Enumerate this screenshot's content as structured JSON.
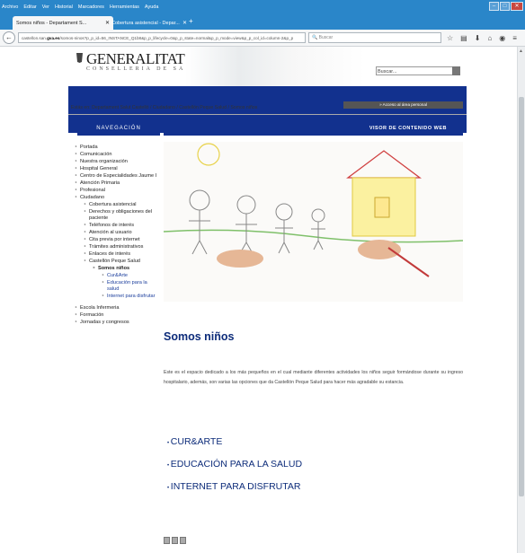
{
  "browser": {
    "menu": [
      "Archivo",
      "Editar",
      "Ver",
      "Historial",
      "Marcadores",
      "Herramientas",
      "Ayuda"
    ],
    "tabs": [
      {
        "label": "Somos niños - Departament S...",
        "active": true
      },
      {
        "label": "Cobertura asistencial - Depar...",
        "active": false
      }
    ],
    "url_prefix": "castellon.san.",
    "url_domain": "gva.es",
    "url_rest": "/somos-ninos?p_p_id=56_INSTANCE_Q1b8&p_p_lifecycle=0&p_p_state=normal&p_p_mode=view&p_p_col_id=column-2&p_p",
    "search_placeholder": "Buscar"
  },
  "header": {
    "title": "GENERALITAT VALENCIANA",
    "subtitle": "CONSELLERIA DE SANITAT",
    "search_label": "Buscar..."
  },
  "breadcrumb": "Estás en:  Departament Salut Castelló  /  Ciudadano  /  Castellón Peque Salud  /  Somos niños",
  "access_button": "» Acceso al área personal",
  "sidebar": {
    "heading": "NAVEGACIÓN",
    "items": [
      {
        "label": "Portada",
        "level": 0
      },
      {
        "label": "Comunicación",
        "level": 0
      },
      {
        "label": "Nuestra organización",
        "level": 0
      },
      {
        "label": "Hospital General",
        "level": 0
      },
      {
        "label": "Centro de Especialidades Jaume I",
        "level": 0
      },
      {
        "label": "Atención Primaria",
        "level": 0
      },
      {
        "label": "Profesional",
        "level": 0
      },
      {
        "label": "Ciudadano",
        "level": 0
      },
      {
        "label": "Cobertura asistencial",
        "level": 1
      },
      {
        "label": "Derechos y obligaciones del paciente",
        "level": 1
      },
      {
        "label": "Teléfonos de interés",
        "level": 1
      },
      {
        "label": "Atención al usuario",
        "level": 1
      },
      {
        "label": "Cita previa por internet",
        "level": 1
      },
      {
        "label": "Trámites administrativos",
        "level": 1
      },
      {
        "label": "Enlaces de interés",
        "level": 1
      },
      {
        "label": "Castellón Peque Salud",
        "level": 1
      },
      {
        "label": "Somos niños",
        "level": 2
      },
      {
        "label": "Cur&Arte",
        "level": 3
      },
      {
        "label": "Educación para la salud",
        "level": 3
      },
      {
        "label": "Internet para disfrutar",
        "level": 3
      },
      {
        "label": "Escola Infermeria",
        "level": 0
      },
      {
        "label": "Formación",
        "level": 0
      },
      {
        "label": "Jornadas y congresos",
        "level": 0
      }
    ]
  },
  "main": {
    "heading": "VISOR DE CONTENIDO WEB",
    "title": "Somos niños",
    "intro": "Este es el espacio dedicado a los más pequeños en el cual mediante diferentes actividades los niños seguir formándose durante su ingreso hospitalario, además, son varias las opciones que da Castellón Peque Salud para hacer más agradable su estancia.",
    "links": [
      "CUR&ARTE",
      "EDUCACIÓN PARA LA SALUD",
      "INTERNET PARA DISFRUTAR"
    ]
  },
  "colors": {
    "brand": "#12318e",
    "chrome": "#2a86c9"
  }
}
